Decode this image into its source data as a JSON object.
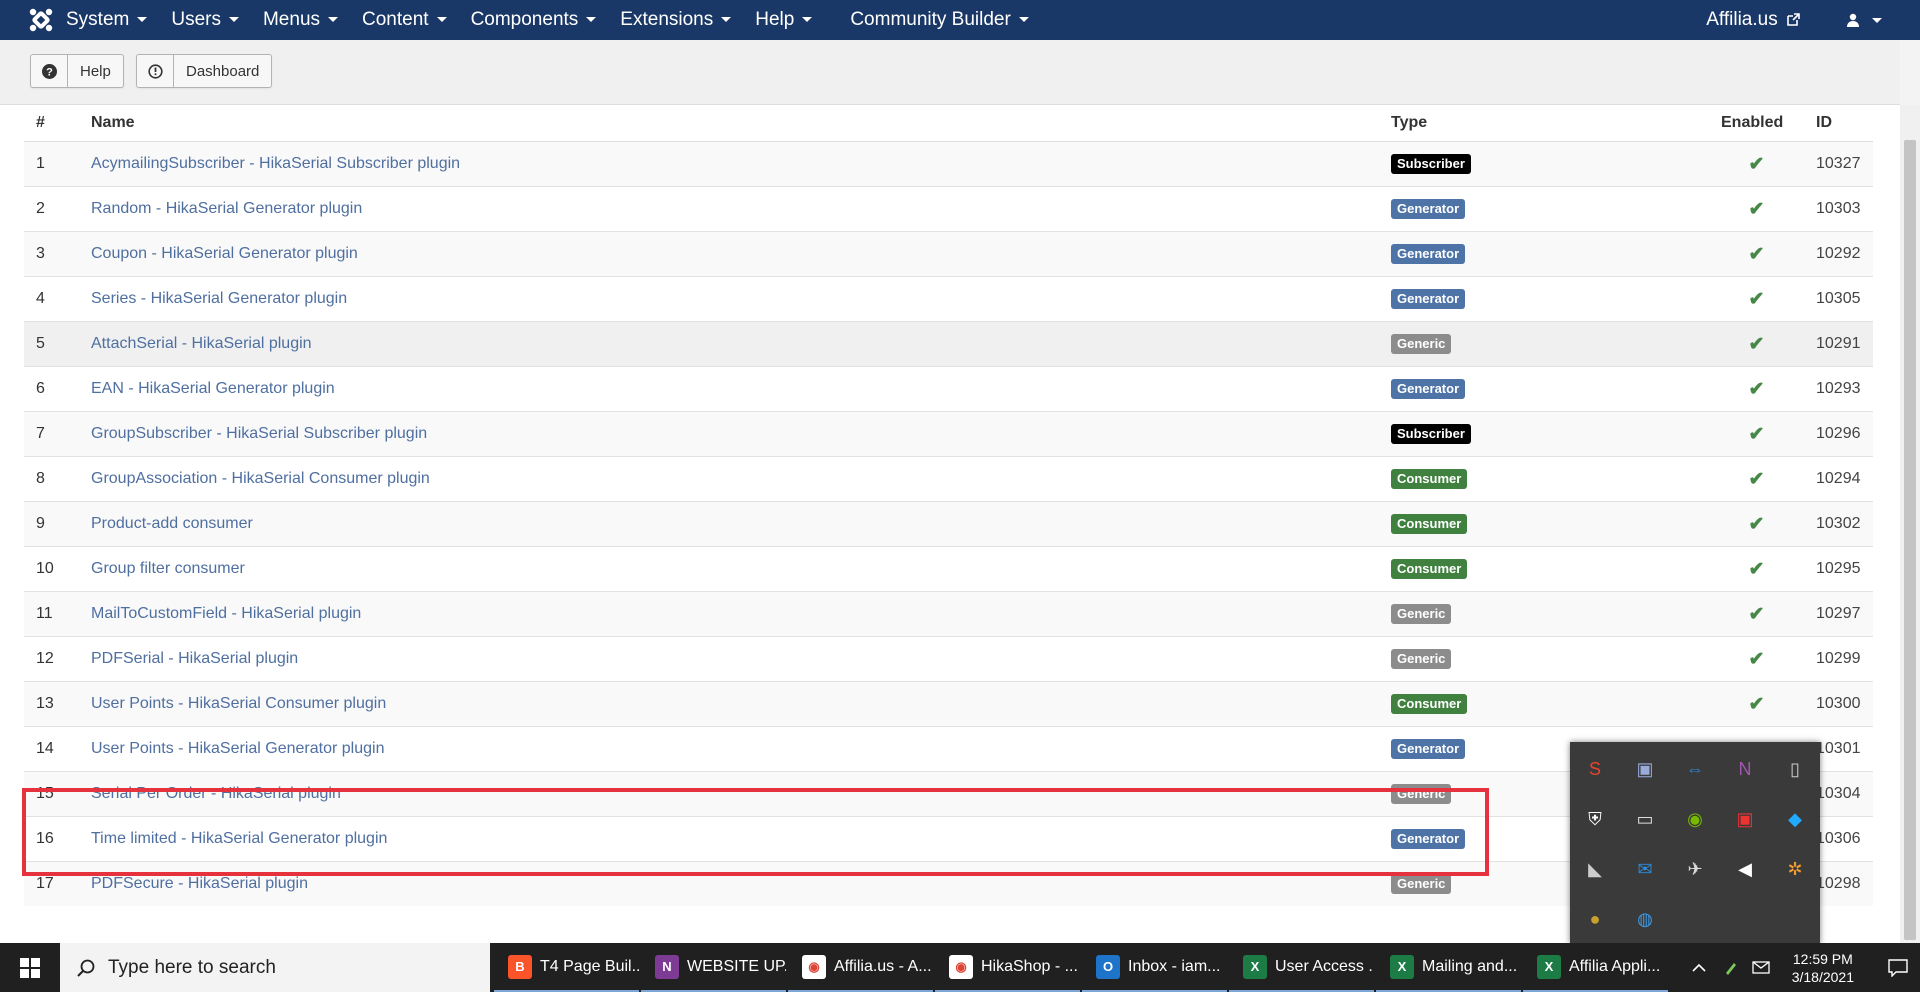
{
  "navbar": {
    "menu": [
      "System",
      "Users",
      "Menus",
      "Content",
      "Components",
      "Extensions",
      "Help"
    ],
    "community_builder": "Community Builder",
    "site_link": "Affilia.us"
  },
  "toolbar": {
    "help_label": "Help",
    "dashboard_label": "Dashboard"
  },
  "table": {
    "headers": {
      "num": "#",
      "name": "Name",
      "type": "Type",
      "enabled": "Enabled",
      "id": "ID"
    },
    "rows": [
      {
        "num": "1",
        "name": "AcymailingSubscriber - HikaSerial Subscriber plugin",
        "type": "Subscriber",
        "enabled": "✔",
        "id": "10327"
      },
      {
        "num": "2",
        "name": "Random - HikaSerial Generator plugin",
        "type": "Generator",
        "enabled": "✔",
        "id": "10303"
      },
      {
        "num": "3",
        "name": "Coupon - HikaSerial Generator plugin",
        "type": "Generator",
        "enabled": "✔",
        "id": "10292"
      },
      {
        "num": "4",
        "name": "Series - HikaSerial Generator plugin",
        "type": "Generator",
        "enabled": "✔",
        "id": "10305"
      },
      {
        "num": "5",
        "name": "AttachSerial - HikaSerial plugin",
        "type": "Generic",
        "enabled": "✔",
        "id": "10291"
      },
      {
        "num": "6",
        "name": "EAN - HikaSerial Generator plugin",
        "type": "Generator",
        "enabled": "✔",
        "id": "10293"
      },
      {
        "num": "7",
        "name": "GroupSubscriber - HikaSerial Subscriber plugin",
        "type": "Subscriber",
        "enabled": "✔",
        "id": "10296"
      },
      {
        "num": "8",
        "name": "GroupAssociation - HikaSerial Consumer plugin",
        "type": "Consumer",
        "enabled": "✔",
        "id": "10294"
      },
      {
        "num": "9",
        "name": "Product-add consumer",
        "type": "Consumer",
        "enabled": "✔",
        "id": "10302"
      },
      {
        "num": "10",
        "name": "Group filter consumer",
        "type": "Consumer",
        "enabled": "✔",
        "id": "10295"
      },
      {
        "num": "11",
        "name": "MailToCustomField - HikaSerial plugin",
        "type": "Generic",
        "enabled": "✔",
        "id": "10297"
      },
      {
        "num": "12",
        "name": "PDFSerial - HikaSerial plugin",
        "type": "Generic",
        "enabled": "✔",
        "id": "10299"
      },
      {
        "num": "13",
        "name": "User Points - HikaSerial Consumer plugin",
        "type": "Consumer",
        "enabled": "✔",
        "id": "10300"
      },
      {
        "num": "14",
        "name": "User Points - HikaSerial Generator plugin",
        "type": "Generator",
        "enabled": "",
        "id": "10301"
      },
      {
        "num": "15",
        "name": "Serial Per Order - HikaSerial plugin",
        "type": "Generic",
        "enabled": "",
        "id": "10304"
      },
      {
        "num": "16",
        "name": "Time limited - HikaSerial Generator plugin",
        "type": "Generator",
        "enabled": "",
        "id": "10306"
      },
      {
        "num": "17",
        "name": "PDFSecure - HikaSerial plugin",
        "type": "Generic",
        "enabled": "",
        "id": "10298"
      }
    ]
  },
  "badge_colors": {
    "Subscriber": "#000000",
    "Generator": "#4e73a6",
    "Consumer": "#408140",
    "Generic": "#8c8c8c"
  },
  "tray": {
    "icons": [
      "snagit-icon",
      "network-monitor-icon",
      "teamviewer-icon",
      "onenote-sync-icon",
      "usb-drive-icon",
      "security-shield-icon",
      "display-icon",
      "nvidia-icon",
      "defender-icon",
      "vpn-icon",
      "wifi-tray-icon",
      "chat-icon",
      "satellite-icon",
      "volume-icon",
      "orange-app-icon",
      "bee-icon",
      "globe-icon"
    ]
  },
  "taskbar": {
    "search_placeholder": "Type here to search",
    "apps": [
      {
        "icon": "brave-icon",
        "label": "T4 Page Buil..."
      },
      {
        "icon": "onenote-icon",
        "label": "WEBSITE UP..."
      },
      {
        "icon": "chrome-icon",
        "label": "Affilia.us - A..."
      },
      {
        "icon": "chrome-icon",
        "label": "HikaShop - ..."
      },
      {
        "icon": "outlook-icon",
        "label": "Inbox - iam..."
      },
      {
        "icon": "excel-icon",
        "label": "User Access ..."
      },
      {
        "icon": "excel-icon",
        "label": "Mailing and..."
      },
      {
        "icon": "excel-icon",
        "label": "Affilia Appli..."
      }
    ],
    "time": "12:59 PM",
    "date": "3/18/2021"
  }
}
